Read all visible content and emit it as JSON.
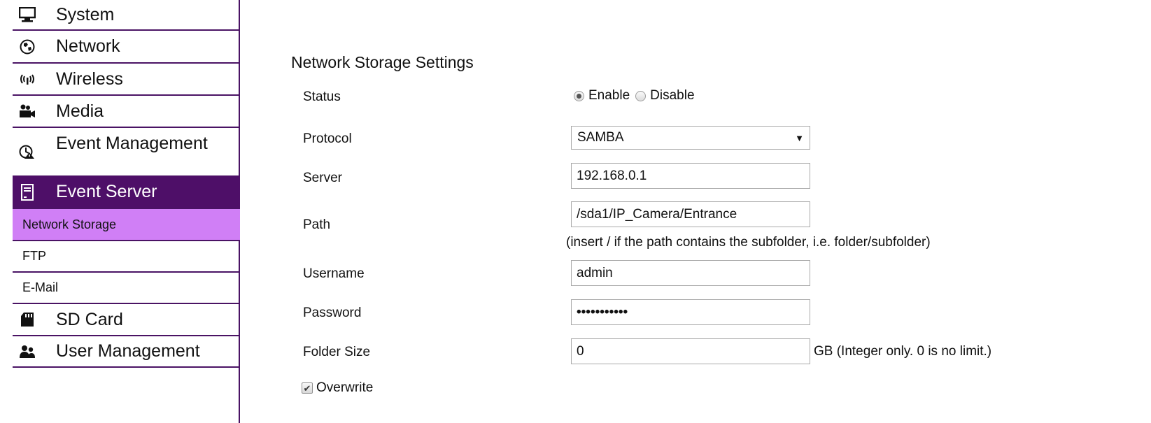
{
  "sidebar": {
    "items": [
      {
        "label": "System",
        "icon": "monitor-icon"
      },
      {
        "label": "Network",
        "icon": "globe-icon"
      },
      {
        "label": "Wireless",
        "icon": "wireless-icon"
      },
      {
        "label": "Media",
        "icon": "camera-icon"
      },
      {
        "label": "Event Management",
        "icon": "event-management-icon"
      },
      {
        "label": "Event Server",
        "icon": "server-icon",
        "active": true
      }
    ],
    "sub_items": [
      {
        "label": "Network Storage",
        "selected": true
      },
      {
        "label": "FTP"
      },
      {
        "label": "E-Mail"
      }
    ],
    "bottom_items": [
      {
        "label": "SD Card",
        "icon": "sd-card-icon"
      },
      {
        "label": "User Management",
        "icon": "users-icon"
      }
    ]
  },
  "main": {
    "title": "Network Storage Settings",
    "status": {
      "label": "Status",
      "options": [
        "Enable",
        "Disable"
      ],
      "selected": "Enable"
    },
    "protocol": {
      "label": "Protocol",
      "value": "SAMBA"
    },
    "server": {
      "label": "Server",
      "value": "192.168.0.1"
    },
    "path": {
      "label": "Path",
      "value": "/sda1/IP_Camera/Entrance",
      "hint": "(insert / if the path contains the subfolder, i.e. folder/subfolder)"
    },
    "username": {
      "label": "Username",
      "value": "admin"
    },
    "password": {
      "label": "Password",
      "value": "•••••••••••"
    },
    "folder_size": {
      "label": "Folder Size",
      "value": "0",
      "unit_hint": "GB (Integer only. 0 is no limit.)"
    },
    "overwrite": {
      "label": "Overwrite",
      "checked": true
    }
  },
  "colors": {
    "sidebar_border": "#4a1364",
    "active_nav_bg": "#4e0f68",
    "selected_sub_bg": "#d07ff6"
  }
}
